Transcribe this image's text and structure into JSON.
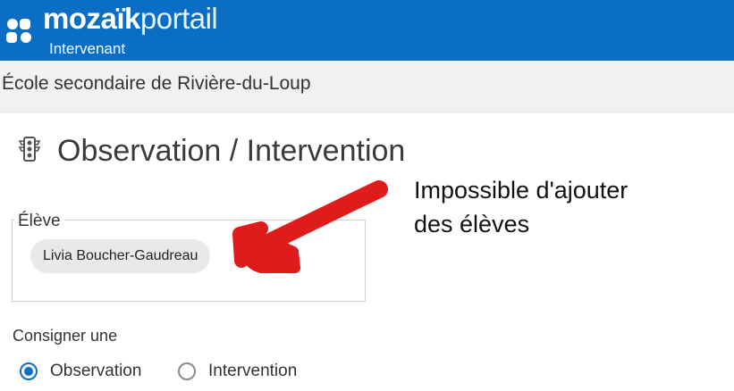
{
  "header": {
    "brand_bold": "mozaïk",
    "brand_light": "portail",
    "role": "Intervenant",
    "logo_icon": "mozaik-logo-icon",
    "background": "#0a6fc4"
  },
  "school_bar": {
    "name": "École secondaire de Rivière-du-Loup"
  },
  "page": {
    "icon": "traffic-light-icon",
    "title": "Observation / Intervention"
  },
  "eleve_field": {
    "legend": "Élève",
    "chips": [
      "Livia Boucher-Gaudreau"
    ]
  },
  "consigner": {
    "label": "Consigner une",
    "options": [
      {
        "label": "Observation",
        "checked": true
      },
      {
        "label": "Intervention",
        "checked": false
      }
    ]
  },
  "annotation": {
    "line1": "Impossible d'ajouter",
    "line2": "des élèves",
    "arrow_color": "#e01b1b"
  }
}
